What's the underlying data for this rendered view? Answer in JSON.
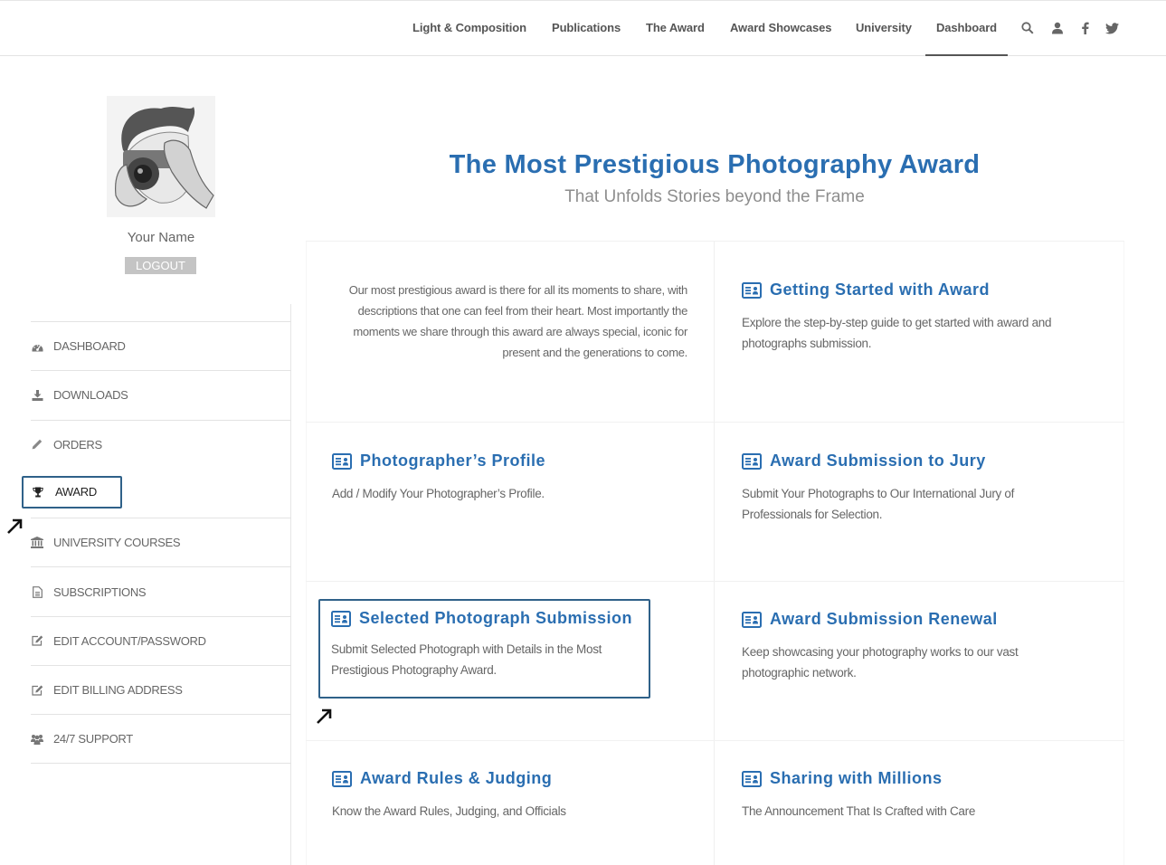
{
  "nav": {
    "items": [
      {
        "label": "Light & Composition",
        "active": false
      },
      {
        "label": "Publications",
        "active": false
      },
      {
        "label": "The Award",
        "active": false
      },
      {
        "label": "Award Showcases",
        "active": false
      },
      {
        "label": "University",
        "active": false
      },
      {
        "label": "Dashboard",
        "active": true
      }
    ],
    "icons": [
      "search-icon",
      "user-icon",
      "facebook-icon",
      "twitter-icon"
    ]
  },
  "profile": {
    "name": "Your Name",
    "logout_label": "LOGOUT"
  },
  "sidebar": {
    "items": [
      {
        "label": "DASHBOARD",
        "icon": "dashboard-icon"
      },
      {
        "label": "DOWNLOADS",
        "icon": "download-icon"
      },
      {
        "label": "ORDERS",
        "icon": "pencil-icon"
      },
      {
        "label": "AWARD",
        "icon": "trophy-icon",
        "active": true
      },
      {
        "label": "UNIVERSITY COURSES",
        "icon": "institution-icon"
      },
      {
        "label": "SUBSCRIPTIONS",
        "icon": "document-icon"
      },
      {
        "label": "EDIT ACCOUNT/PASSWORD",
        "icon": "edit-icon"
      },
      {
        "label": "EDIT BILLING ADDRESS",
        "icon": "edit-icon"
      },
      {
        "label": "24/7 SUPPORT",
        "icon": "users-icon"
      }
    ]
  },
  "hero": {
    "title": "The Most Prestigious Photography Award",
    "subtitle": "That Unfolds Stories beyond the Frame"
  },
  "intro": "Our most prestigious award is there for all its moments to share, with descriptions that one can feel from their heart. Most importantly the moments we share through this award are always special, iconic for present and the generations to come.",
  "cards": [
    {
      "title": "Getting Started with Award",
      "desc": "Explore the step-by-step guide to get started with award and photographs submission."
    },
    {
      "title": "Photographer’s Profile",
      "desc": "Add / Modify Your Photographer’s Profile."
    },
    {
      "title": "Award Submission to Jury",
      "desc": "Submit Your Photographs to Our International Jury of Professionals for Selection."
    },
    {
      "title": "Selected Photograph Submission",
      "desc": "Submit Selected Photograph with Details in the Most Prestigious Photography Award.",
      "highlighted": true
    },
    {
      "title": "Award Submission Renewal",
      "desc": "Keep showcasing your photography works to our vast photographic network."
    },
    {
      "title": "Award Rules & Judging",
      "desc": "Know the Award Rules, Judging, and Officials"
    },
    {
      "title": "Sharing with Millions",
      "desc": "The Announcement That Is Crafted with Care"
    }
  ],
  "colors": {
    "accent": "#2a6eb1",
    "highlight_border": "#2f6189",
    "text": "#666666"
  }
}
